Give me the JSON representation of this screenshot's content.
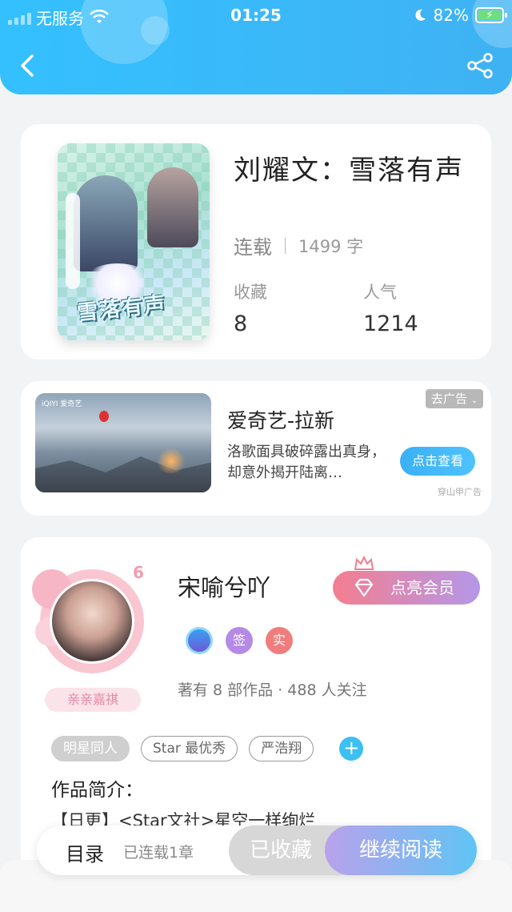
{
  "status_bar": {
    "carrier": "无服务",
    "time": "01:25",
    "battery": "82%"
  },
  "header": {
    "back_icon": "chevron-left-icon",
    "share_icon": "share-icon"
  },
  "book": {
    "title": "刘耀文：雪落有声",
    "status": "连载",
    "word_count": "1499 字",
    "collect_label": "收藏",
    "collect_value": "8",
    "popularity_label": "人气",
    "popularity_value": "1214",
    "cover_text": "雪落有声"
  },
  "ad": {
    "title": "爱奇艺-拉新",
    "description": "洛歌面具破碎露出真身，却意外揭开陆离…",
    "button": "点击查看",
    "tag": "去广告",
    "source": "穿山甲广告",
    "logo": "iQIYI 爱奇艺"
  },
  "author": {
    "name": "宋喻兮吖",
    "level": "6",
    "nickname_tag": "亲亲嘉祺",
    "vip_button": "点亮会员",
    "badges": [
      "",
      "签",
      "实"
    ],
    "meta": "著有 8 部作品 · 488 人关注",
    "tags": [
      "明星同人",
      "Star 最优秀",
      "严浩翔"
    ],
    "add_tag": "+",
    "intro_title": "作品简介：",
    "intro_text": "【日更】<Star文社>星空一样绚烂"
  },
  "bottom_bar": {
    "toc": "目录",
    "chapter_count": "已连载1章",
    "collected": "已收藏",
    "continue": "继续阅读"
  },
  "colors": {
    "header": "#3fb2f3",
    "read_button_start": "#b9a2ec",
    "read_button_end": "#5fc4f4",
    "vip_start": "#f47e8f",
    "vip_end": "#b497e8"
  }
}
